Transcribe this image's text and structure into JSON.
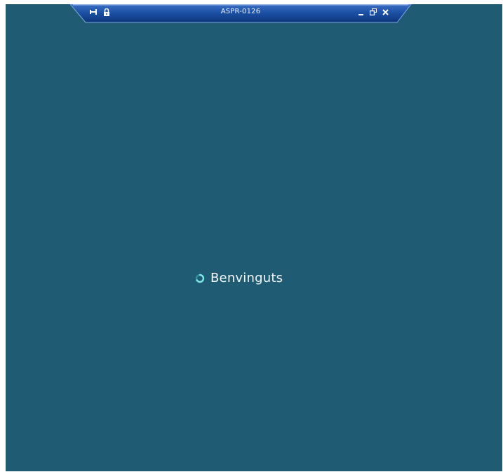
{
  "connection_bar": {
    "title": "ASPR-0126",
    "left_icons": [
      "pin-icon",
      "lock-icon"
    ],
    "right_icons": [
      "minimize-icon",
      "restore-icon",
      "close-icon"
    ]
  },
  "welcome": {
    "text": "Benvinguts",
    "icon": "loading-spinner-icon"
  },
  "colors": {
    "desktop_background": "#1f5c74",
    "bar_background": "#0f3f8a",
    "spinner": "#5fd7d7"
  }
}
